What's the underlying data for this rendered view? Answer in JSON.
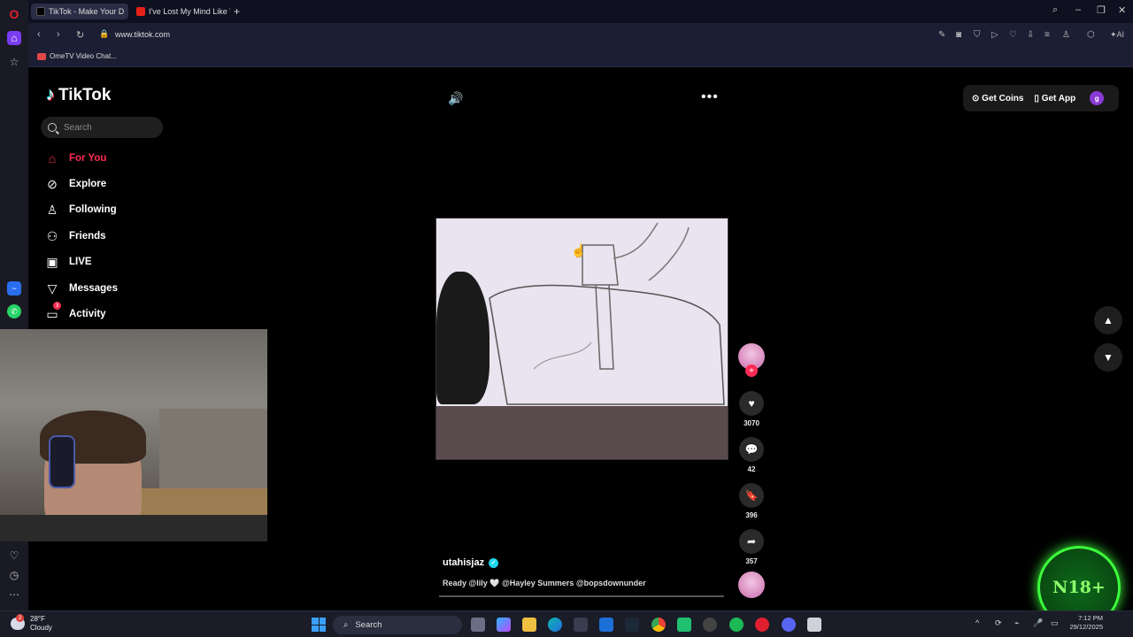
{
  "browser": {
    "tabs": [
      {
        "label": "TikTok - Make Your D",
        "active": true
      },
      {
        "label": "I've Lost My Mind Like Vin",
        "active": false
      }
    ],
    "new_tab_label": "+",
    "url": "www.tiktok.com",
    "bookmarks": [
      {
        "label": "OmeTV Video Chat..."
      }
    ]
  },
  "tiktok": {
    "logo_text": "TikTok",
    "search_placeholder": "Search",
    "nav": [
      {
        "label": "For You",
        "icon": "home-icon",
        "active": true
      },
      {
        "label": "Explore",
        "icon": "compass-icon"
      },
      {
        "label": "Following",
        "icon": "following-icon"
      },
      {
        "label": "Friends",
        "icon": "friends-icon"
      },
      {
        "label": "LIVE",
        "icon": "live-icon"
      },
      {
        "label": "Messages",
        "icon": "messages-icon"
      },
      {
        "label": "Activity",
        "icon": "activity-icon",
        "badge": "3"
      }
    ],
    "header": {
      "get_coins": "Get Coins",
      "get_app": "Get App",
      "profile_initial": "g"
    },
    "post": {
      "username": "utahisjaz",
      "caption": "Ready @lily 🤍  @Hayley Summers @bopsdownunder",
      "likes": "3070",
      "comments": "42",
      "bookmarks": "396",
      "shares": "357"
    }
  },
  "overlay": {
    "badge_text": "N18+"
  },
  "taskbar": {
    "weather_temp": "28°F",
    "weather_desc": "Cloudy",
    "weather_badge": "2",
    "search_label": "Search",
    "time": "7:12 PM",
    "date": "29/12/2025"
  },
  "colors": {
    "accent": "#fe2c55",
    "verified": "#20d5ec",
    "n18_glow": "#3cff3c"
  }
}
